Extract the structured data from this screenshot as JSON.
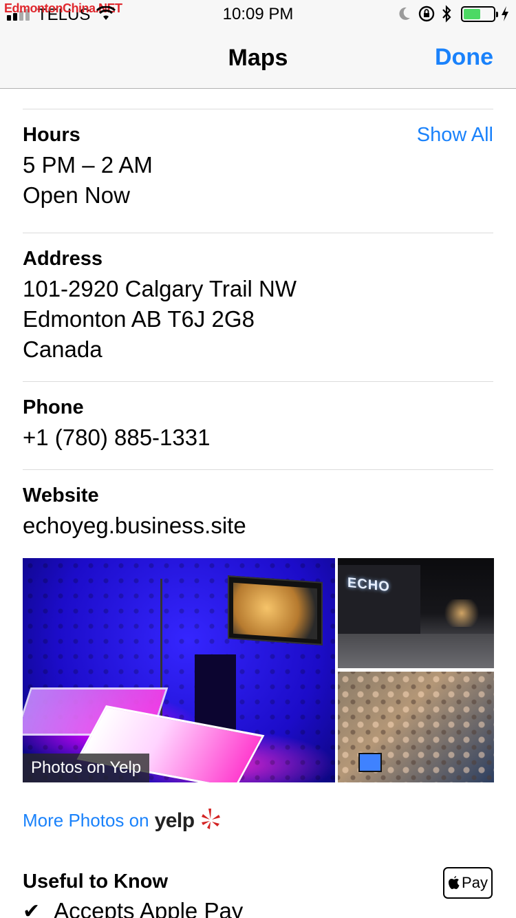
{
  "status_bar": {
    "watermark": "EdmontonChina.NET",
    "carrier": "TELUS",
    "time": "10:09 PM",
    "battery_level": 0.58,
    "icons": [
      "signal-icon",
      "wifi-icon",
      "moon-icon",
      "rotation-lock-icon",
      "bluetooth-icon",
      "battery-icon",
      "charging-icon"
    ]
  },
  "nav": {
    "title": "Maps",
    "done_label": "Done"
  },
  "hours": {
    "label": "Hours",
    "show_all": "Show All",
    "range": "5 PM – 2 AM",
    "status": "Open Now"
  },
  "address": {
    "label": "Address",
    "line1": "101-2920 Calgary Trail NW",
    "line2": "Edmonton AB T6J 2G8",
    "line3": "Canada"
  },
  "phone": {
    "label": "Phone",
    "number": "+1 (780) 885-1331"
  },
  "website": {
    "label": "Website",
    "url": "echoyeg.business.site"
  },
  "photos": {
    "badge": "Photos on Yelp",
    "night_sign": "ECHO",
    "more_label": "More Photos on",
    "yelp_word": "yelp"
  },
  "useful": {
    "label": "Useful to Know",
    "apple_pay_badge": "Pay",
    "item": "Accepts Apple Pay"
  },
  "colors": {
    "accent": "#1a82fb",
    "battery": "#4cd964",
    "divider": "#dcdcdc"
  }
}
